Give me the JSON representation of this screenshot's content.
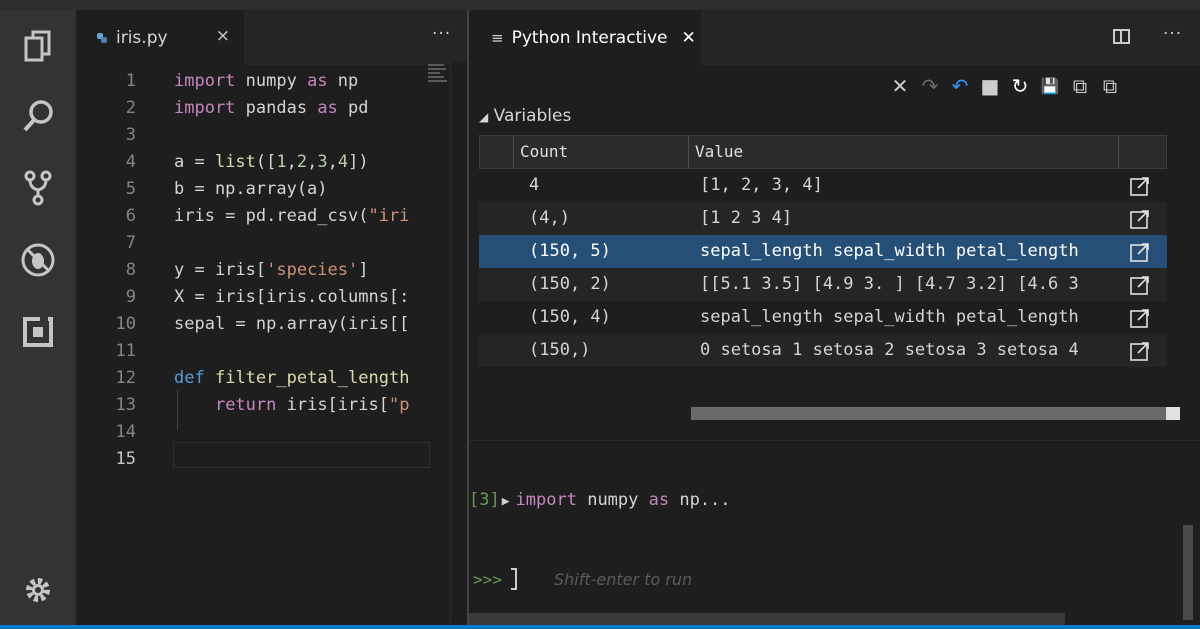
{
  "activity_bar": {
    "icons": [
      "explorer-icon",
      "search-icon",
      "source-control-icon",
      "debug-icon",
      "extensions-icon",
      "settings-gear-icon"
    ]
  },
  "editor": {
    "tab": {
      "filename": "iris.py",
      "close": "×"
    },
    "more": "···",
    "lines": [
      {
        "n": "1",
        "tokens": [
          {
            "t": "import",
            "c": "kw"
          },
          {
            "t": " numpy ",
            "c": ""
          },
          {
            "t": "as",
            "c": "kw"
          },
          {
            "t": " np",
            "c": ""
          }
        ]
      },
      {
        "n": "2",
        "tokens": [
          {
            "t": "import",
            "c": "kw"
          },
          {
            "t": " pandas ",
            "c": ""
          },
          {
            "t": "as",
            "c": "kw"
          },
          {
            "t": " pd",
            "c": ""
          }
        ]
      },
      {
        "n": "3",
        "tokens": []
      },
      {
        "n": "4",
        "tokens": [
          {
            "t": "a = ",
            "c": ""
          },
          {
            "t": "list",
            "c": "fn"
          },
          {
            "t": "([",
            "c": ""
          },
          {
            "t": "1",
            "c": "nm"
          },
          {
            "t": ",",
            "c": ""
          },
          {
            "t": "2",
            "c": "nm"
          },
          {
            "t": ",",
            "c": ""
          },
          {
            "t": "3",
            "c": "nm"
          },
          {
            "t": ",",
            "c": ""
          },
          {
            "t": "4",
            "c": "nm"
          },
          {
            "t": "])",
            "c": ""
          }
        ]
      },
      {
        "n": "5",
        "tokens": [
          {
            "t": "b = np.array(a)",
            "c": ""
          }
        ]
      },
      {
        "n": "6",
        "tokens": [
          {
            "t": "iris = pd.read_csv(",
            "c": ""
          },
          {
            "t": "\"iri",
            "c": "st"
          }
        ]
      },
      {
        "n": "7",
        "tokens": []
      },
      {
        "n": "8",
        "tokens": [
          {
            "t": "y = iris[",
            "c": ""
          },
          {
            "t": "'species'",
            "c": "st"
          },
          {
            "t": "]",
            "c": ""
          }
        ]
      },
      {
        "n": "9",
        "tokens": [
          {
            "t": "X = iris[iris.columns[:",
            "c": ""
          }
        ]
      },
      {
        "n": "10",
        "tokens": [
          {
            "t": "sepal = np.array(iris[[",
            "c": ""
          }
        ]
      },
      {
        "n": "11",
        "tokens": []
      },
      {
        "n": "12",
        "tokens": [
          {
            "t": "def",
            "c": "kb"
          },
          {
            "t": " ",
            "c": ""
          },
          {
            "t": "filter_petal_length",
            "c": "fn"
          }
        ]
      },
      {
        "n": "13",
        "tokens": [
          {
            "t": "    ",
            "c": ""
          },
          {
            "t": "return",
            "c": "kw"
          },
          {
            "t": " iris[iris[",
            "c": ""
          },
          {
            "t": "\"p",
            "c": "st"
          }
        ]
      },
      {
        "n": "14",
        "tokens": []
      },
      {
        "n": "15",
        "tokens": []
      }
    ]
  },
  "interactive": {
    "tab": {
      "icon": "≡",
      "title": "Python Interactive",
      "close": "✕"
    },
    "more": "···",
    "toolbar": [
      {
        "name": "clear-icon",
        "glyph": "✕",
        "color": "#cccccc"
      },
      {
        "name": "redo-icon",
        "glyph": "↷",
        "color": "#6b6b6b"
      },
      {
        "name": "undo-icon",
        "glyph": "↶",
        "color": "#3794ff"
      },
      {
        "name": "stop-icon",
        "glyph": "■",
        "color": "#cccccc"
      },
      {
        "name": "restart-icon",
        "glyph": "↻",
        "color": "#ffffff"
      },
      {
        "name": "save-icon",
        "glyph": "💾",
        "color": "#3794ff"
      },
      {
        "name": "collapse-all-icon",
        "glyph": "⧉",
        "color": "#cccccc"
      },
      {
        "name": "expand-all-icon",
        "glyph": "⧉",
        "color": "#cccccc"
      }
    ],
    "variables": {
      "header": "Variables",
      "columns": {
        "count": "Count",
        "value": "Value"
      },
      "rows": [
        {
          "count": "4",
          "value": "[1, 2, 3, 4]",
          "selected": false
        },
        {
          "count": "(4,)",
          "value": "[1 2 3 4]",
          "selected": false
        },
        {
          "count": "(150, 5)",
          "value": "sepal_length sepal_width petal_length",
          "selected": true
        },
        {
          "count": "(150, 2)",
          "value": "[[5.1 3.5] [4.9 3. ] [4.7 3.2] [4.6 3",
          "selected": false
        },
        {
          "count": "(150, 4)",
          "value": "sepal_length sepal_width petal_length",
          "selected": false
        },
        {
          "count": "(150,)",
          "value": "0 setosa 1 setosa 2 setosa 3 setosa 4",
          "selected": false
        }
      ]
    },
    "cell": {
      "number": "[3]",
      "code": "import numpy as np..."
    },
    "input": {
      "prompt": ">>>",
      "placeholder": "Shift-enter to run"
    }
  },
  "colors": {
    "accent": "#007acc",
    "selection": "#264f78"
  }
}
